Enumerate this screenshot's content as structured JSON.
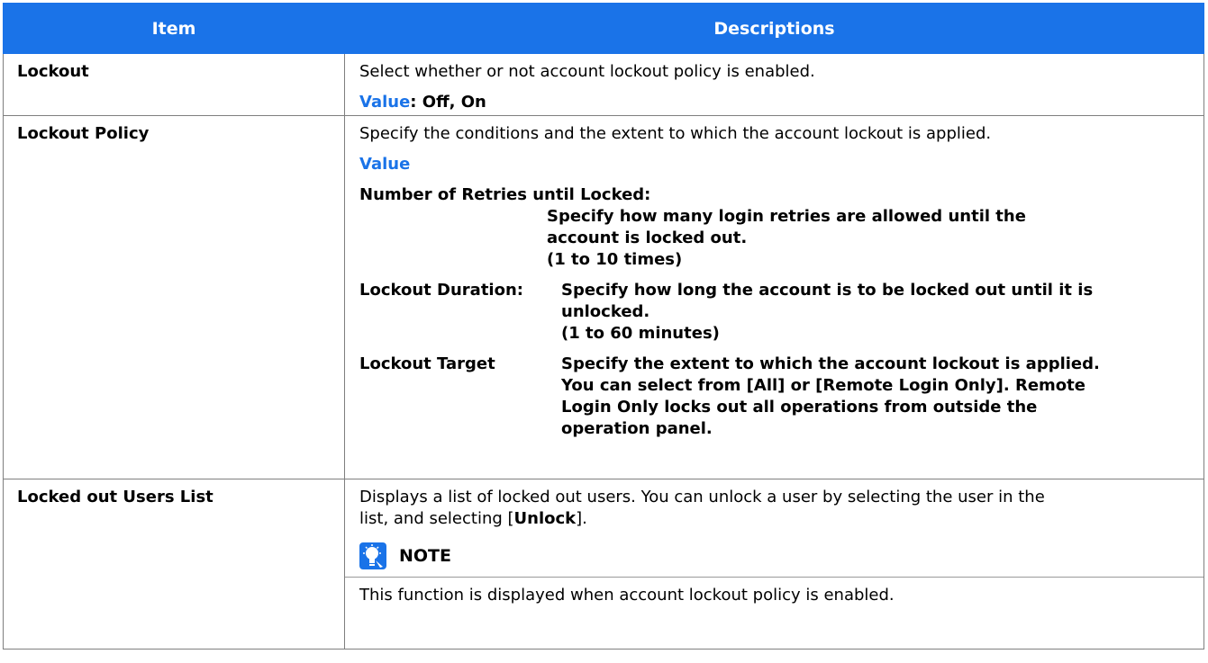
{
  "table": {
    "header_item": "Item",
    "header_desc": "Descriptions"
  },
  "rows": {
    "lockout": {
      "item": "Lockout",
      "desc": "Select whether or not account lockout policy is enabled.",
      "value_label": "Value",
      "value_text": ": Off, On"
    },
    "policy": {
      "item": "Lockout Policy",
      "desc": "Specify the conditions and the extent to which the account lockout is applied.",
      "value_label": "Value",
      "retries_label": "Number of Retries until Locked:",
      "retries_line1": "Specify how many login retries are allowed until the",
      "retries_line2": "account is locked out.",
      "retries_line3": "(1 to 10 times)",
      "duration_label": "Lockout Duration:",
      "duration_line1": "Specify how long the account is to be locked out until it is",
      "duration_line2": "unlocked.",
      "duration_line3": "(1 to 60 minutes)",
      "target_label": "Lockout Target",
      "target_line1": "Specify the extent to which the account lockout is applied.",
      "target_line2": "You can select from [All] or [Remote Login Only]. Remote",
      "target_line3": "Login Only locks out all operations from outside the",
      "target_line4": "operation panel."
    },
    "users_list": {
      "item": "Locked out Users List",
      "desc_line1": "Displays a list of locked out users. You can unlock a user by selecting the user in the",
      "desc_line2_pre": "list, and selecting [",
      "desc_line2_bold": "Unlock",
      "desc_line2_post": "].",
      "note_label": "NOTE",
      "note_icon": "lightbulb-note-icon",
      "note_text": "This function is displayed when account lockout policy is enabled."
    }
  },
  "colors": {
    "accent": "#1a73e8",
    "border": "#7f7f7f"
  }
}
